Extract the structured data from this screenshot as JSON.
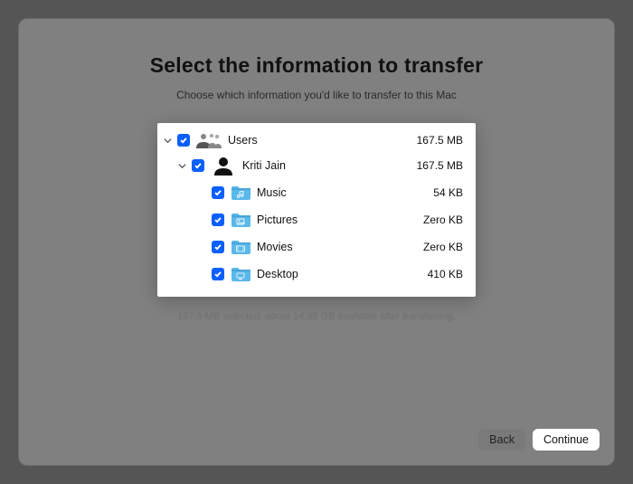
{
  "header": {
    "title": "Select the information to transfer",
    "subtitle": "Choose which information you'd like to transfer to this Mac"
  },
  "tree": {
    "users": {
      "label": "Users",
      "size": "167.5 MB"
    },
    "user1": {
      "label": "Kriti Jain",
      "size": "167.5 MB"
    },
    "music": {
      "label": "Music",
      "size": "54 KB"
    },
    "pictures": {
      "label": "Pictures",
      "size": "Zero KB"
    },
    "movies": {
      "label": "Movies",
      "size": "Zero KB"
    },
    "desktop": {
      "label": "Desktop",
      "size": "410 KB"
    }
  },
  "status": "167.5 MB selected, about 14.38 GB available after transferring.",
  "buttons": {
    "back": "Back",
    "continue": "Continue"
  }
}
